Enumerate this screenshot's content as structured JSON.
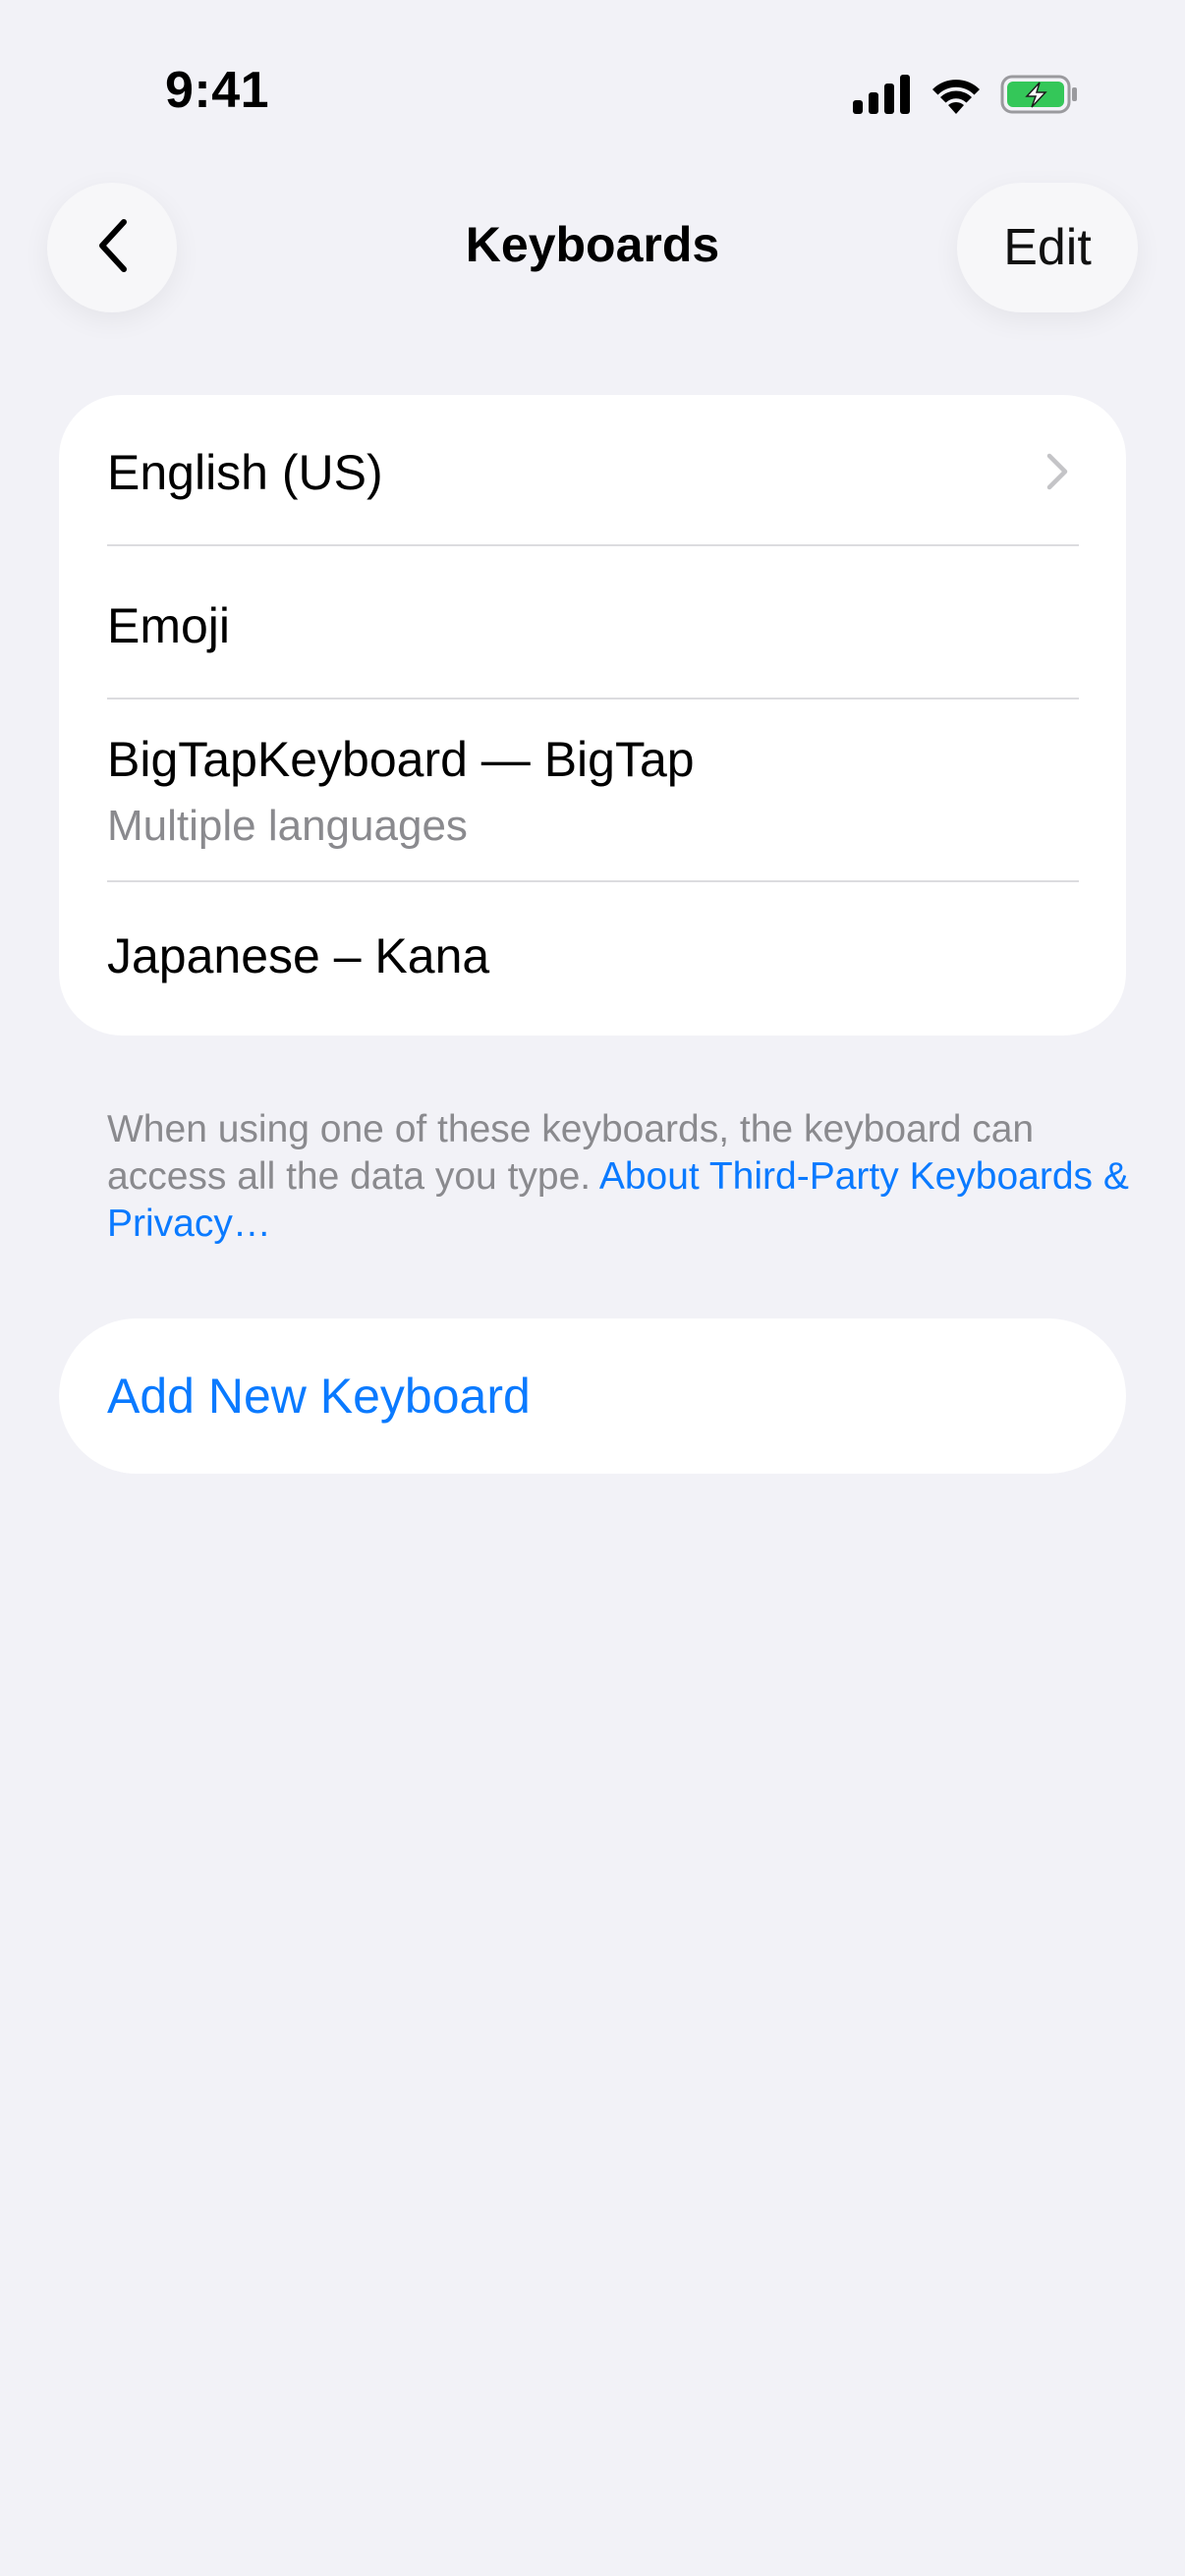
{
  "status_bar": {
    "time": "9:41",
    "icons": [
      "cellular-signal-icon",
      "wifi-icon",
      "battery-charging-icon"
    ],
    "battery_color": "#34C759"
  },
  "nav": {
    "back_icon": "chevron-left-icon",
    "title": "Keyboards",
    "edit_label": "Edit"
  },
  "keyboards": [
    {
      "label": "English (US)",
      "sublabel": "",
      "has_chevron": true
    },
    {
      "label": "Emoji",
      "sublabel": ""
    },
    {
      "label": "BigTapKeyboard — BigTap",
      "sublabel": "Multiple languages"
    },
    {
      "label": "Japanese – Kana",
      "sublabel": ""
    }
  ],
  "footer": {
    "text": "When using one of these keyboards, the keyboard can access all the data you type. ",
    "link": "About Third-Party Keyboards & Privacy…"
  },
  "add_keyboard": {
    "label": "Add New Keyboard"
  },
  "colors": {
    "background": "#F2F2F7",
    "accent": "#0A7AFF",
    "secondary_text": "#8A8A8E"
  }
}
